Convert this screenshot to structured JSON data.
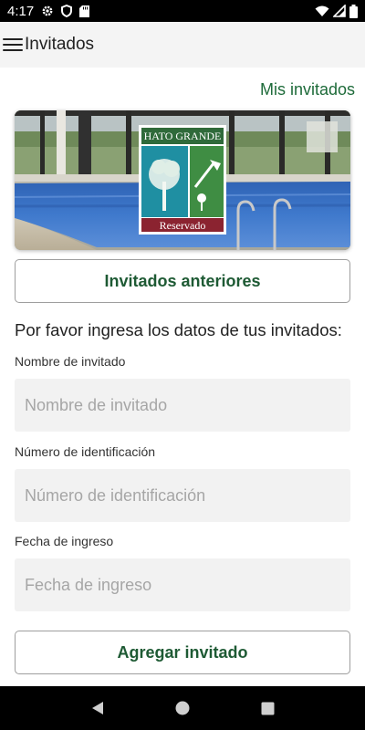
{
  "status_bar": {
    "time": "4:17",
    "icons": [
      "settings-icon",
      "shield-icon",
      "sd-card-icon",
      "wifi-icon",
      "signal-icon",
      "battery-icon"
    ]
  },
  "app_bar": {
    "title": "Invitados",
    "menu_icon": "menu-icon"
  },
  "links": {
    "mis_invitados": "Mis invitados"
  },
  "banner": {
    "logo_top_text": "HATO GRANDE",
    "logo_bottom_text": "Reservado"
  },
  "buttons": {
    "previous_guests": "Invitados anteriores",
    "add_guest": "Agregar invitado"
  },
  "form": {
    "prompt": "Por favor ingresa los datos de tus invitados:",
    "fields": [
      {
        "label": "Nombre de invitado",
        "placeholder": "Nombre de invitado",
        "value": ""
      },
      {
        "label": "Número de identificación",
        "placeholder": "Número de identificación",
        "value": ""
      },
      {
        "label": "Fecha de ingreso",
        "placeholder": "Fecha de ingreso",
        "value": ""
      }
    ]
  },
  "nav_bar": {
    "icons": [
      "back-icon",
      "home-icon",
      "recents-icon"
    ]
  },
  "colors": {
    "accent_green": "#1e6b3a",
    "logo_green": "#2f6a3a",
    "logo_red": "#8b2330",
    "app_bar_bg": "#f4f4f4",
    "input_bg": "#f2f2f2"
  }
}
